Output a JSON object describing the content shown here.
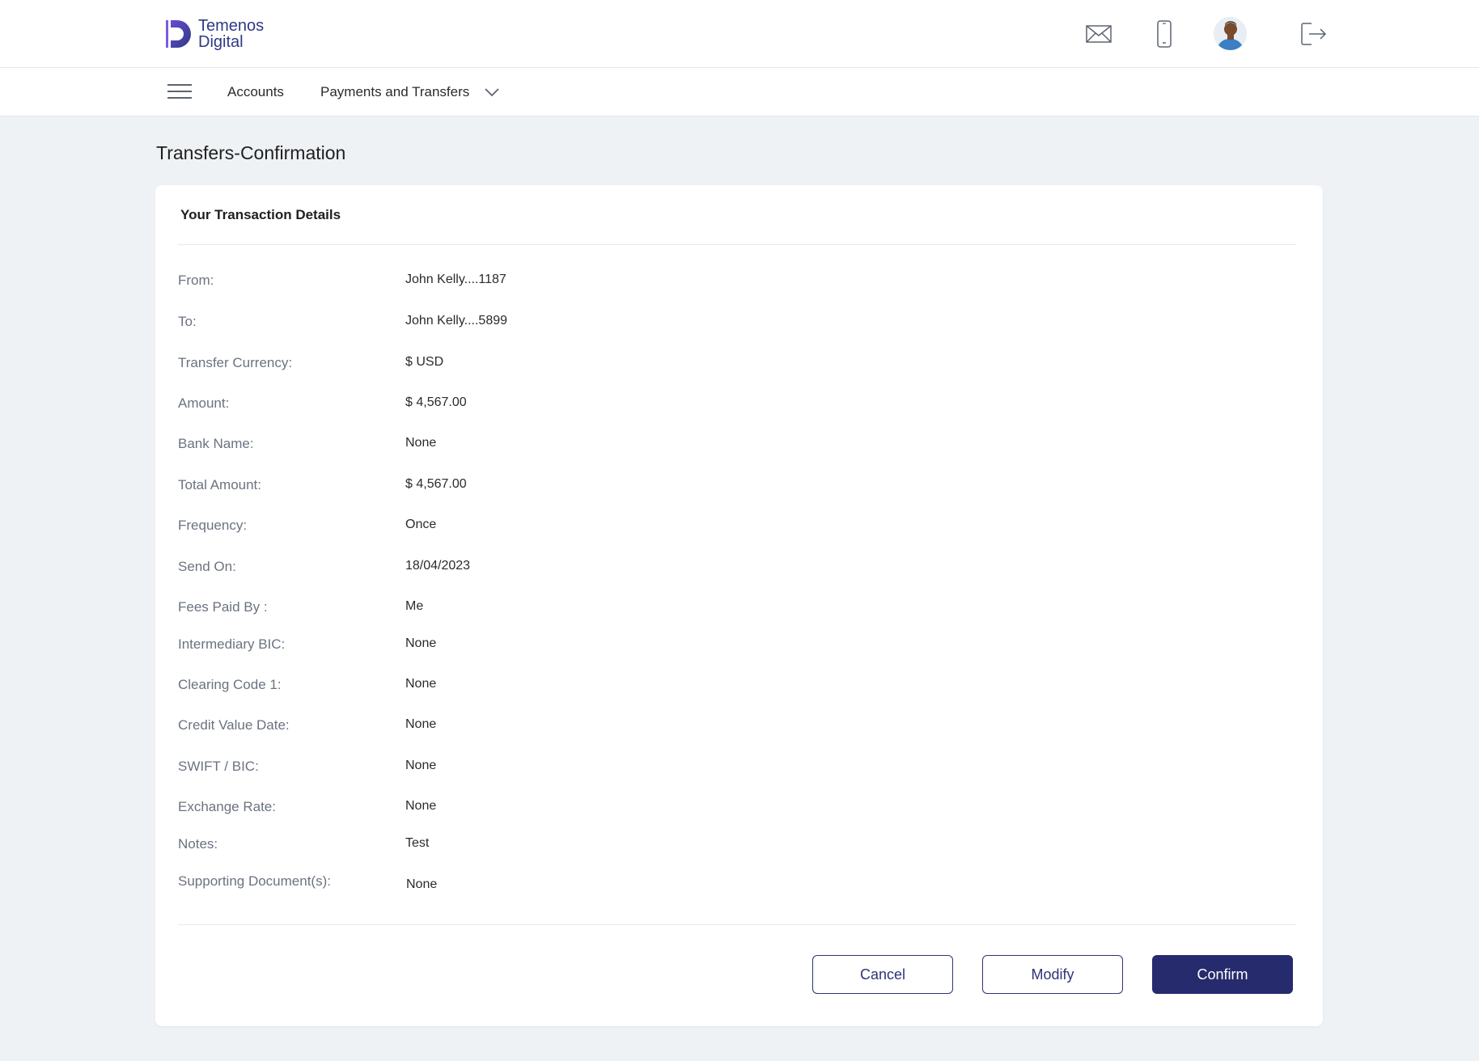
{
  "brand": {
    "line1": "Temenos",
    "line2": "Digital",
    "color": "#2e3a86"
  },
  "header_icons": [
    "mail-icon",
    "mobile-phone-icon",
    "user-avatar",
    "logout-icon"
  ],
  "nav": {
    "menu_icon": "hamburger-icon",
    "accounts": "Accounts",
    "payments": "Payments and Transfers",
    "dropdown_icon": "chevron-down-icon"
  },
  "page": {
    "title": "Transfers-Confirmation"
  },
  "card": {
    "heading": "Your Transaction Details",
    "rows": [
      {
        "label": "From:",
        "value": "John Kelly....1187"
      },
      {
        "label": "To:",
        "value": "John Kelly....5899"
      },
      {
        "label": "Transfer Currency:",
        "value": "$ USD"
      },
      {
        "label": "Amount:",
        "value": "$ 4,567.00"
      },
      {
        "label": "Bank Name:",
        "value": "None"
      },
      {
        "label": "Total Amount:",
        "value": "$ 4,567.00"
      },
      {
        "label": "Frequency:",
        "value": "Once"
      },
      {
        "label": "Send On:",
        "value": "18/04/2023"
      },
      {
        "label": "Fees Paid By :",
        "value": "Me"
      },
      {
        "label": "Intermediary BIC:",
        "value": "None"
      },
      {
        "label": "Clearing Code 1:",
        "value": "None"
      },
      {
        "label": "Credit Value Date:",
        "value": "None"
      },
      {
        "label": "SWIFT / BIC:",
        "value": "None"
      },
      {
        "label": "Exchange Rate:",
        "value": "None"
      },
      {
        "label": "Notes:",
        "value": "Test"
      },
      {
        "label": "Supporting Document(s):",
        "value": "None"
      }
    ]
  },
  "actions": {
    "cancel": "Cancel",
    "modify": "Modify",
    "confirm": "Confirm"
  },
  "colors": {
    "primary": "#262b6e",
    "background": "#eff2f5",
    "label": "#6b7280"
  }
}
